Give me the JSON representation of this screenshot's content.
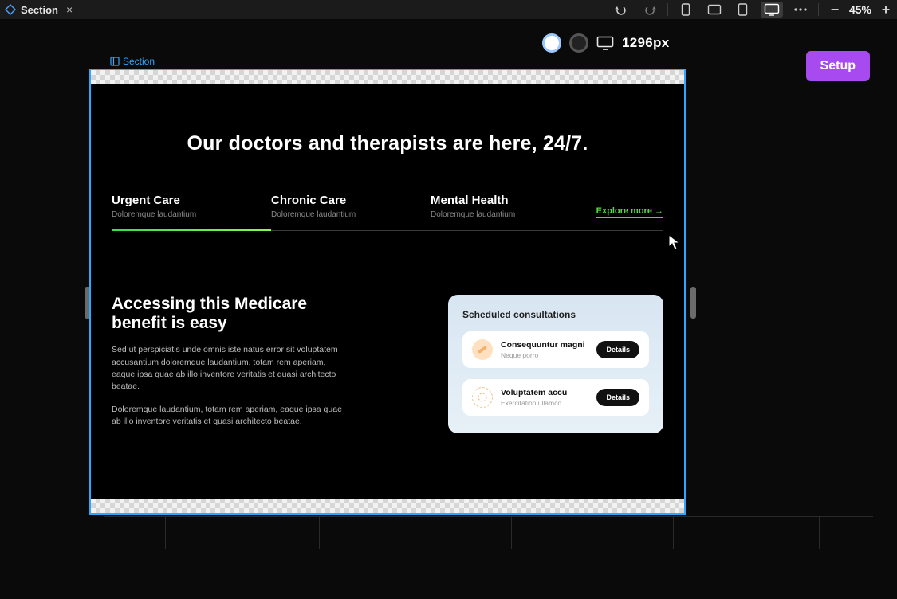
{
  "toolbar": {
    "title": "Section",
    "zoom": "45%"
  },
  "breakpoint": {
    "width_label": "1296px"
  },
  "setup_label": "Setup",
  "selection_label": "Section",
  "page": {
    "hero_title": "Our doctors and therapists are here, 24/7.",
    "tabs": [
      {
        "title": "Urgent Care",
        "subtitle": "Doloremque laudantium"
      },
      {
        "title": "Chronic Care",
        "subtitle": "Doloremque laudantium"
      },
      {
        "title": "Mental Health",
        "subtitle": "Doloremque laudantium"
      }
    ],
    "explore_label": "Explore more →",
    "feature": {
      "heading": "Accessing this Medicare benefit is easy",
      "para1": "Sed ut perspiciatis unde omnis iste natus error sit voluptatem accusantium doloremque laudantium, totam rem aperiam, eaque ipsa quae ab illo inventore veritatis et quasi architecto beatae.",
      "para2": "Doloremque laudantium, totam rem aperiam, eaque ipsa quae ab illo inventore veritatis et quasi architecto beatae."
    },
    "card": {
      "title": "Scheduled consultations",
      "items": [
        {
          "name": "Consequuntur magni",
          "sub": "Neque porro",
          "button": "Details"
        },
        {
          "name": "Voluptatem accu",
          "sub": "Exercitation ullamco",
          "button": "Details"
        }
      ]
    }
  }
}
